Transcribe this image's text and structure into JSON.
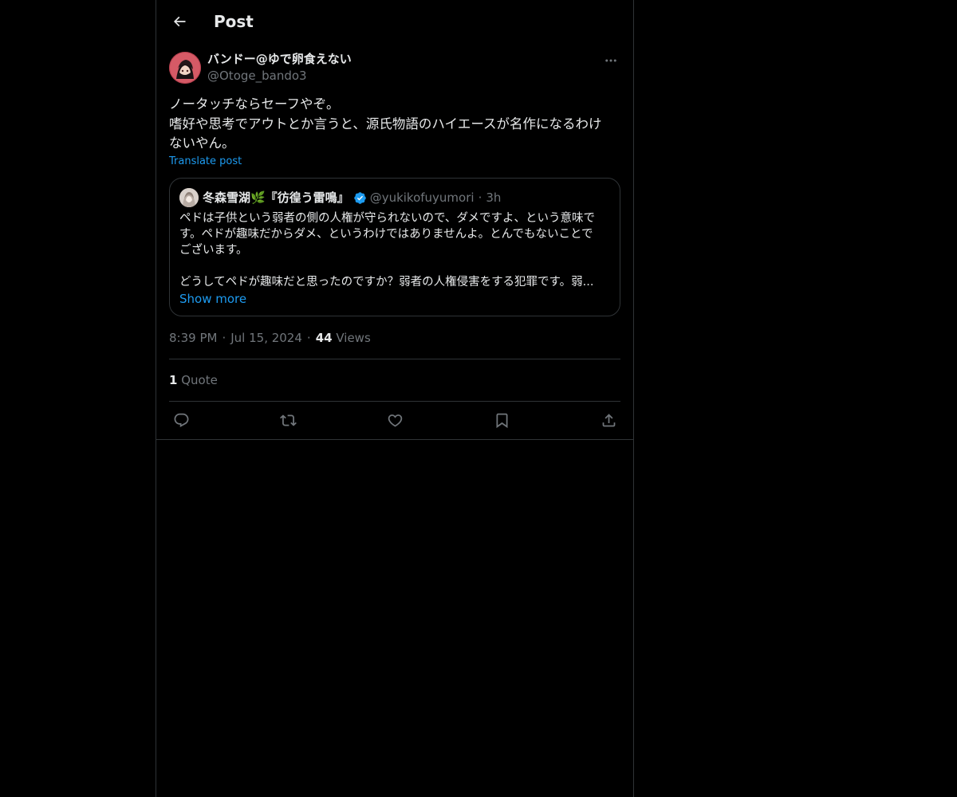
{
  "header": {
    "title": "Post"
  },
  "post": {
    "author_name": "バンドー@ゆで卵食えない",
    "author_handle": "@Otoge_bando3",
    "text_lines": [
      "ノータッチならセーフやぞ。",
      "嗜好や思考でアウトとか言うと、源氏物語のハイエースが名作になるわけ",
      "ないやん。"
    ],
    "translate_label": "Translate post",
    "time": "8:39 PM",
    "date": "Jul 15, 2024",
    "views_count": "44",
    "views_label": "Views",
    "quote_count": "1",
    "quote_label": "Quote"
  },
  "quoted_post": {
    "author_name": "冬森雪湖🌿『彷徨う雷鳴』",
    "author_handle": "@yukikofuyumori",
    "time_ago": "3h",
    "text_lines": [
      "ペドは子供という弱者の側の人権が守られないので、ダメですよ、という意味で",
      "す。ペドが趣味だからダメ、というわけではありませんよ。とんでもないことで",
      "ございます。",
      "",
      "どうしてペドが趣味だと思ったのですか？弱者の人権侵害をする犯罪です。弱..."
    ],
    "show_more_label": "Show more"
  },
  "colors": {
    "background": "#000000",
    "text_primary": "#e7e9ea",
    "text_secondary": "#71767b",
    "accent": "#1d9bf0",
    "border": "#2f3336"
  },
  "icons": {
    "back": "arrow-left-icon",
    "more": "more-horizontal-icon",
    "verified": "verified-badge-icon",
    "reply": "reply-icon",
    "repost": "repost-icon",
    "like": "heart-icon",
    "bookmark": "bookmark-icon",
    "share": "share-icon"
  }
}
